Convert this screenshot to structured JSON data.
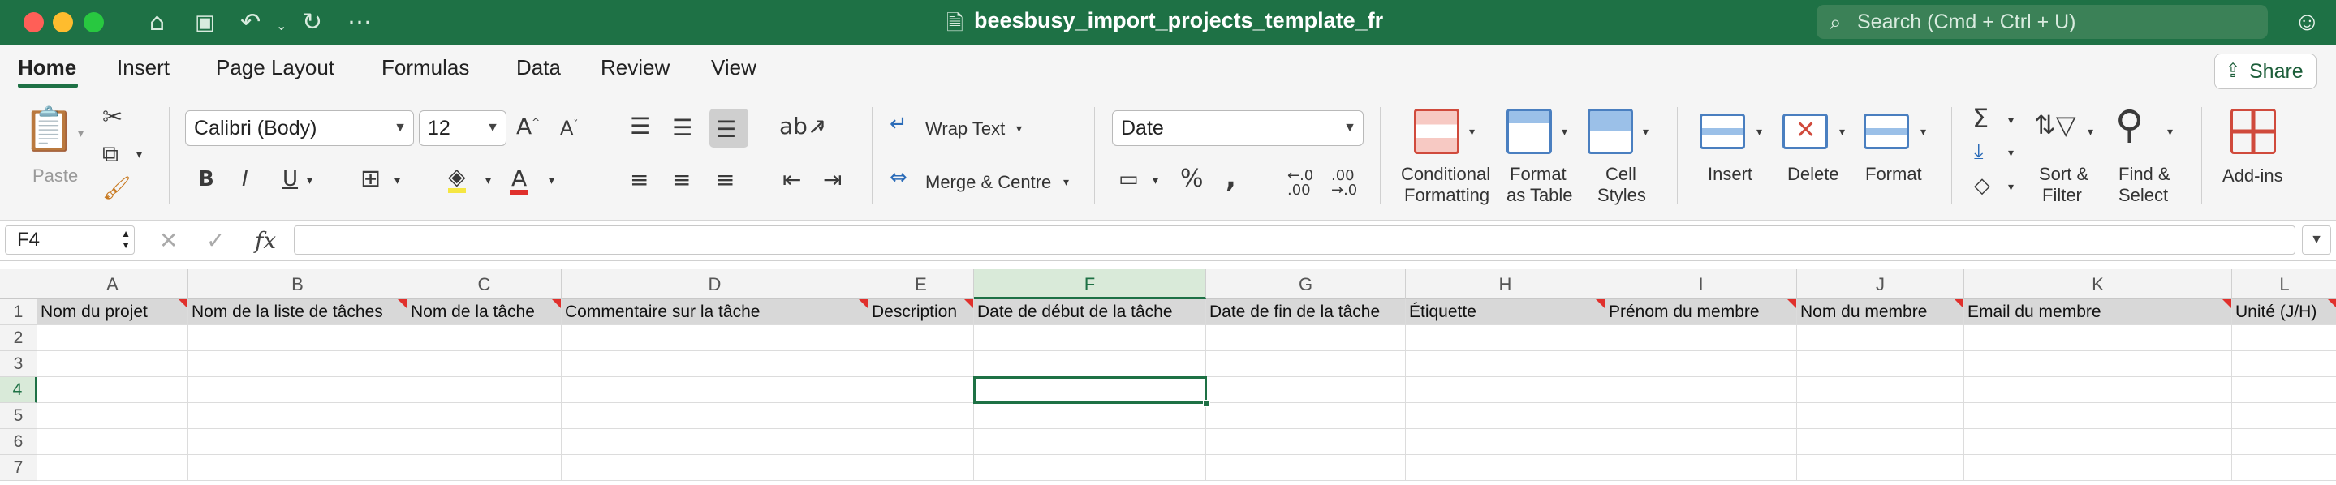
{
  "window": {
    "title": "beesbusy_import_projects_template_fr",
    "search_placeholder": "Search (Cmd + Ctrl + U)",
    "traffic_lights": [
      "#ff5f57",
      "#febc2e",
      "#28c840"
    ]
  },
  "tabs": [
    {
      "label": "Home",
      "active": true
    },
    {
      "label": "Insert"
    },
    {
      "label": "Page Layout"
    },
    {
      "label": "Formulas"
    },
    {
      "label": "Data"
    },
    {
      "label": "Review"
    },
    {
      "label": "View"
    }
  ],
  "share_label": "Share",
  "ribbon": {
    "paste": "Paste",
    "font_name": "Calibri (Body)",
    "font_size": "12",
    "wrap_text": "Wrap Text",
    "merge_centre": "Merge & Centre",
    "number_format": "Date",
    "conditional_formatting": [
      "Conditional",
      "Formatting"
    ],
    "format_as_table": [
      "Format",
      "as Table"
    ],
    "cell_styles": [
      "Cell",
      "Styles"
    ],
    "insert": "Insert",
    "delete": "Delete",
    "format": "Format",
    "sort_filter": [
      "Sort &",
      "Filter"
    ],
    "find_select": [
      "Find &",
      "Select"
    ],
    "addins": "Add-ins",
    "bold": "B",
    "italic": "I",
    "underline": "U",
    "font_color_letter": "A",
    "accent_color": "#1e7145",
    "font_color": "#e0302c",
    "highlight_color": "#f5e642"
  },
  "formula_bar": {
    "name_box": "F4",
    "fx": "fx",
    "value": ""
  },
  "sheet": {
    "columns": [
      "A",
      "B",
      "C",
      "D",
      "E",
      "F",
      "G",
      "H",
      "I",
      "J",
      "K",
      "L"
    ],
    "selected_column": "F",
    "selected_row": "4",
    "rows": [
      "1",
      "2",
      "3",
      "4",
      "5",
      "6",
      "7"
    ],
    "headers": [
      "Nom du projet",
      "Nom de la liste de tâches",
      "Nom de la tâche",
      "Commentaire sur la tâche",
      "Description",
      "Date de début de la tâche",
      "Date de fin de la tâche",
      "Étiquette",
      "Prénom du membre",
      "Nom du membre",
      "Email du membre",
      "Unité (J/H)"
    ],
    "comment_markers": [
      "A",
      "B",
      "C",
      "D",
      "E",
      "H",
      "I",
      "J",
      "K",
      "L"
    ]
  }
}
